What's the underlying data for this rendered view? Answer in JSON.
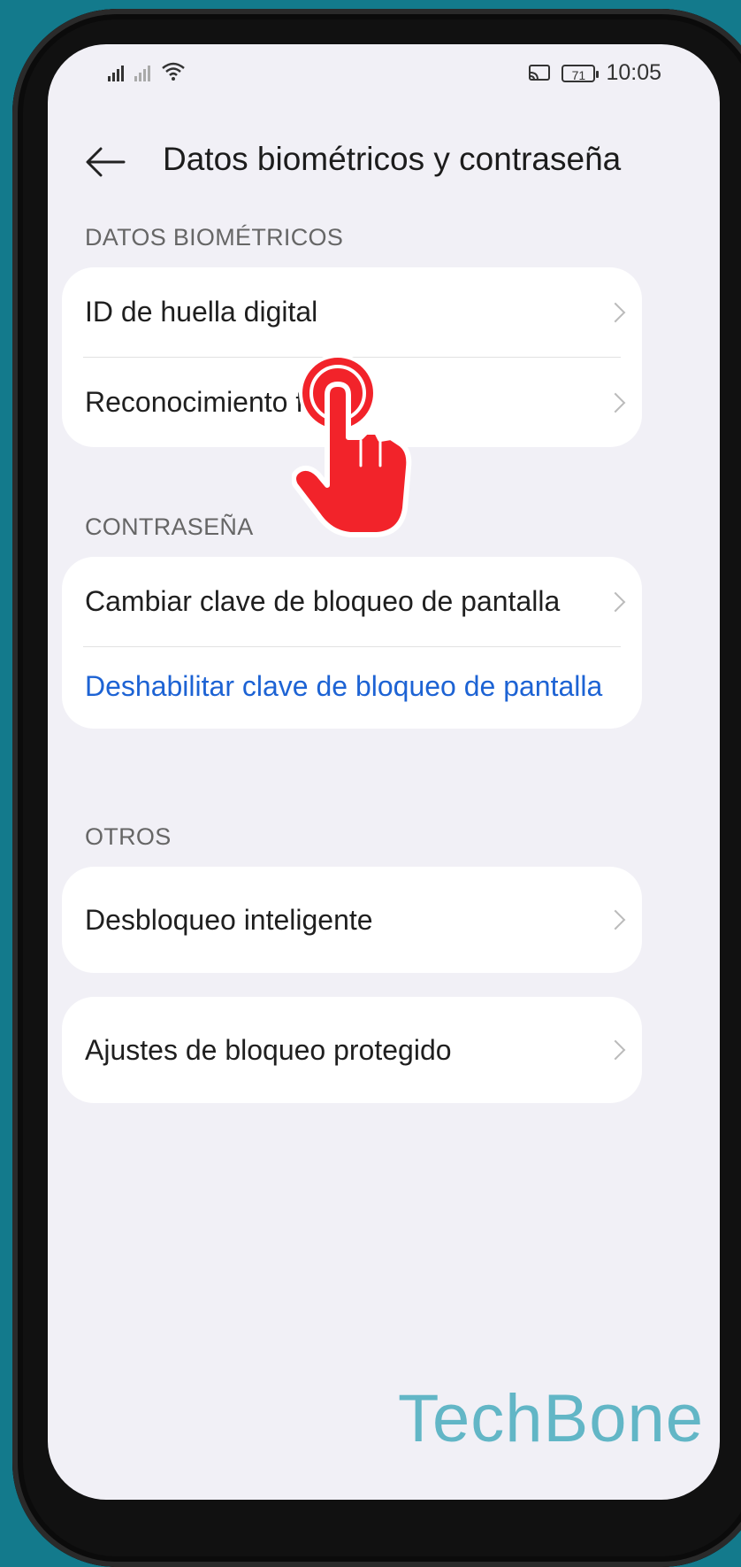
{
  "status_bar": {
    "time": "10:05",
    "battery": "71"
  },
  "header": {
    "title": "Datos biométricos y contraseña"
  },
  "sections": {
    "biometric": {
      "label": "DATOS BIOMÉTRICOS",
      "items": [
        "ID de huella digital",
        "Reconocimiento f"
      ]
    },
    "password": {
      "label": "CONTRASEÑA",
      "change": "Cambiar clave de bloqueo de pantalla",
      "disable": "Deshabilitar clave de bloqueo de pantalla"
    },
    "others": {
      "label": "OTROS",
      "smart_unlock": "Desbloqueo inteligente",
      "protected_lock": "Ajustes de bloqueo protegido"
    }
  },
  "watermark": "TechBone",
  "colors": {
    "background": "#137a8c",
    "link": "#1d63d4",
    "tap_indicator": "#f2232a"
  }
}
